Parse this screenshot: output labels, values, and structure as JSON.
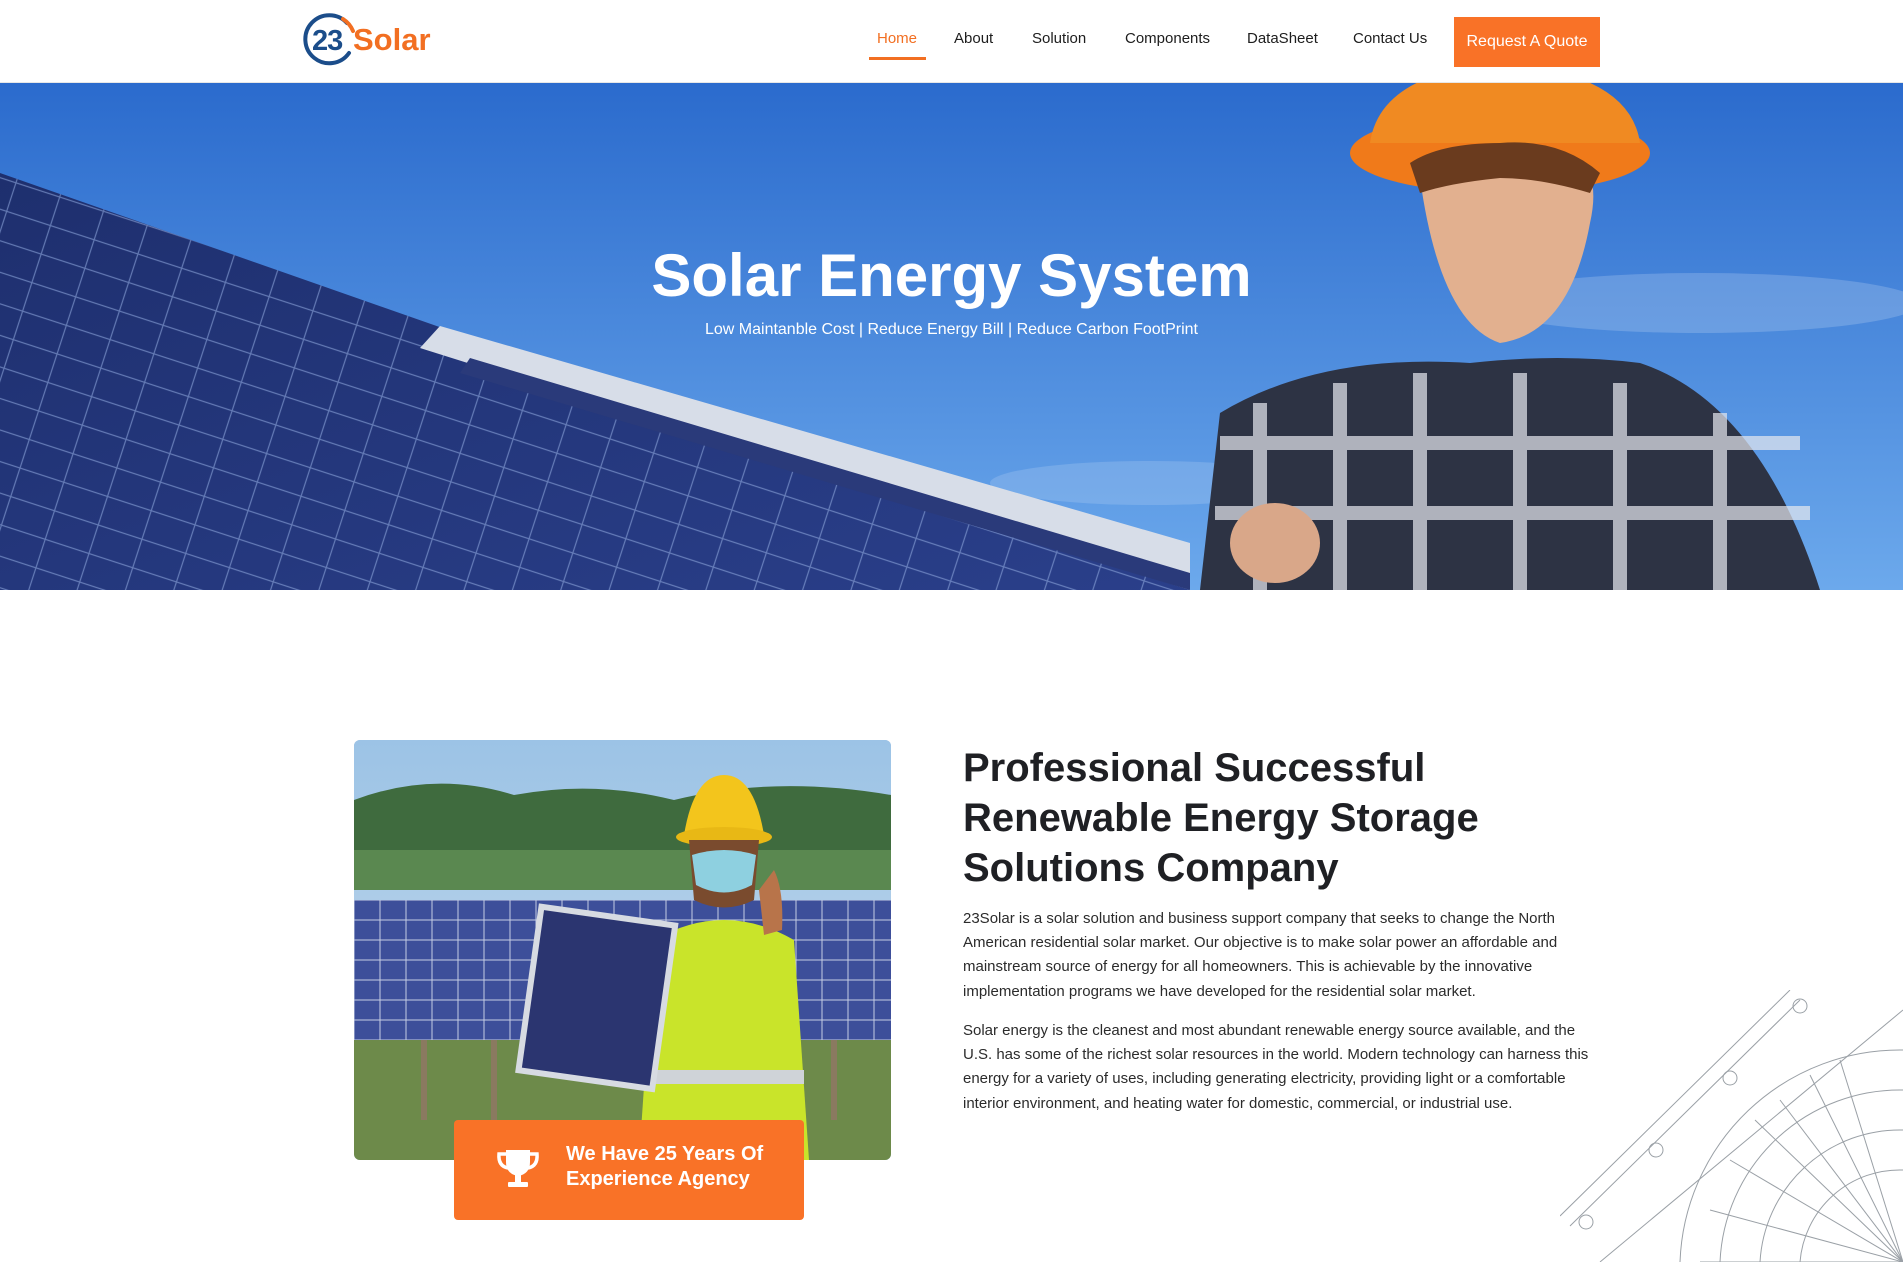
{
  "brand": {
    "logo_number": "23",
    "logo_word": "Solar",
    "accent_color": "#f26f22",
    "navy_color": "#1b4d8a"
  },
  "nav": {
    "items": [
      {
        "label": "Home",
        "active": true
      },
      {
        "label": "About",
        "active": false
      },
      {
        "label": "Solution",
        "active": false
      },
      {
        "label": "Components",
        "active": false
      },
      {
        "label": "DataSheet",
        "active": false
      },
      {
        "label": "Contact Us",
        "active": false
      }
    ],
    "cta_label": "Request A Quote"
  },
  "hero": {
    "title": "Solar Energy System",
    "subtitle": "Low Maintanble Cost | Reduce Energy Bill | Reduce Carbon FootPrint"
  },
  "about": {
    "badge_icon": "trophy-icon",
    "badge_text": "We Have 25 Years Of Experience Agency",
    "title": "Professional Successful Renewable Energy Storage Solutions Company",
    "paragraph1": "23Solar is a solar solution and business support company that seeks to change the North American residential solar market. Our objective is to make solar power an affordable and mainstream source of energy for all homeowners. This is achievable by the innovative implementation programs we have developed for the residential solar market.",
    "paragraph2": "Solar energy is the cleanest and most abundant renewable energy source available, and the U.S. has some of the richest solar resources in the world. Modern technology can harness this energy for a variety of uses, including generating electricity, providing light or a comfortable interior environment, and heating water for domestic, commercial, or industrial use."
  }
}
